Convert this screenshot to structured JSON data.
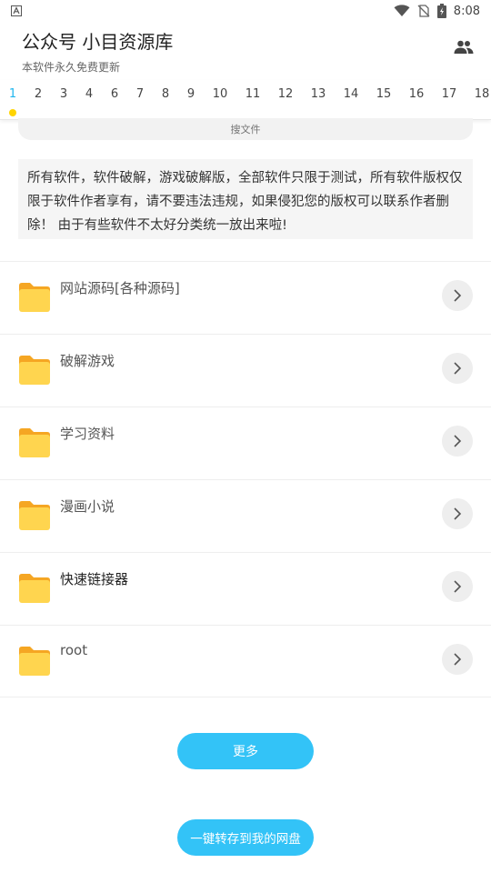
{
  "status_bar": {
    "time": "8:08",
    "left_icon": "app-notification-icon",
    "icons": [
      "wifi-icon",
      "no-sim-icon",
      "battery-charging-icon"
    ]
  },
  "appbar": {
    "title": "公众号 小目资源库",
    "subtitle": "本软件永久免费更新",
    "action_icon": "people-icon"
  },
  "tabs": {
    "active_index": 0,
    "accent_color": "#1fb6ee",
    "indicator_color": "#ffd400",
    "items": [
      "1",
      "2",
      "3",
      "4",
      "6",
      "7",
      "8",
      "9",
      "10",
      "11",
      "12",
      "13",
      "14",
      "15",
      "16",
      "17",
      "18"
    ]
  },
  "search": {
    "placeholder": "搜文件"
  },
  "notice": {
    "text": "所有软件，软件破解，游戏破解版，全部软件只限于测试，所有软件版权仅限于软件作者享有，请不要违法违规，如果侵犯您的版权可以联系作者删除！ 由于有些软件不太好分类统一放出来啦!"
  },
  "list": {
    "folder_color": "#ffd54f",
    "items": [
      {
        "label": "网站源码[各种源码]"
      },
      {
        "label": "破解游戏"
      },
      {
        "label": "学习资料"
      },
      {
        "label": "漫画小说"
      },
      {
        "label": "快速链接器"
      },
      {
        "label": "root"
      }
    ]
  },
  "buttons": {
    "more_label": "更多",
    "save_label": "一键转存到我的网盘",
    "color": "#33c3f7"
  }
}
